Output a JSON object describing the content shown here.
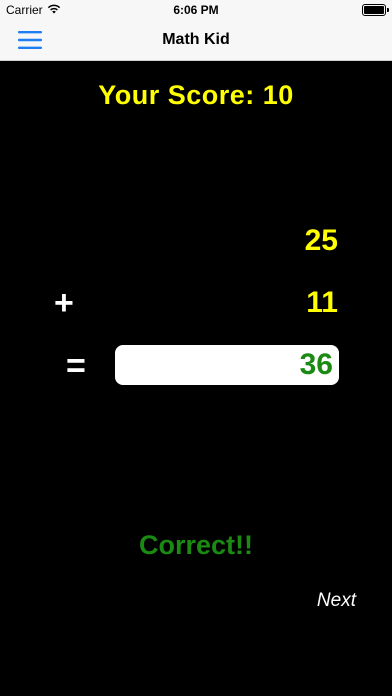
{
  "status_bar": {
    "carrier": "Carrier",
    "time": "6:06 PM",
    "wifi_icon": "wifi-icon",
    "battery_icon": "battery-icon"
  },
  "nav": {
    "title": "Math Kid",
    "menu_icon": "hamburger-menu-icon",
    "accent_color": "#1e7ff5"
  },
  "game": {
    "score_text": "Your Score: 10",
    "operand_1": "25",
    "operator_symbol": "+",
    "operand_2": "11",
    "equals_symbol": "=",
    "answer_value": "36",
    "feedback": "Correct!!",
    "next_label": "Next"
  },
  "colors": {
    "background": "#000000",
    "score": "#ffff00",
    "operands": "#ffff00",
    "correct": "#1a8a12",
    "operators": "#ffffff"
  }
}
